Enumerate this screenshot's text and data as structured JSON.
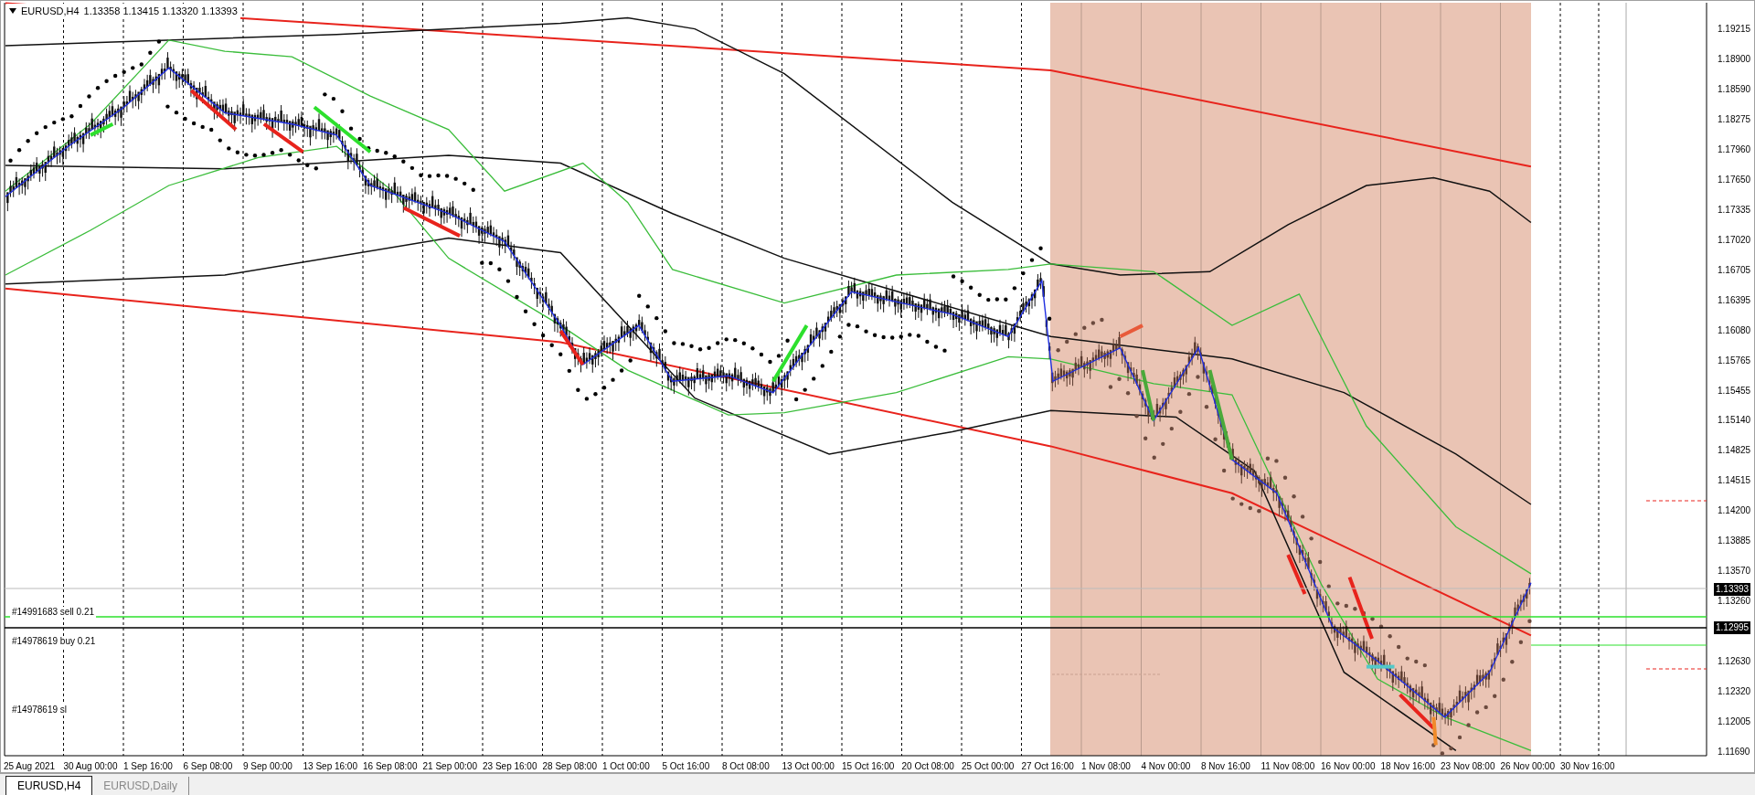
{
  "chart_header": {
    "symbol": "EURUSD,H4",
    "quote": "1.13358 1.13415 1.13320 1.13393"
  },
  "price_axis": {
    "ticks": [
      "1.19215",
      "1.18900",
      "1.18590",
      "1.18275",
      "1.17960",
      "1.17650",
      "1.17335",
      "1.17020",
      "1.16705",
      "1.16395",
      "1.16080",
      "1.15765",
      "1.15455",
      "1.15140",
      "1.14825",
      "1.14515",
      "1.14200",
      "1.13885",
      "1.13570",
      "1.13260",
      "1.12630",
      "1.12320",
      "1.12005",
      "1.11690"
    ],
    "markers": [
      {
        "label": "1.13393",
        "kind": "bid"
      },
      {
        "label": "1.12995",
        "kind": "order"
      }
    ]
  },
  "orders": [
    {
      "label": "#14991683 sell 0.21",
      "kind": "sell"
    },
    {
      "label": "#14978619 buy 0.21",
      "kind": "buy"
    },
    {
      "label": "#14978619 sl",
      "kind": "sl"
    }
  ],
  "time_axis": [
    "25 Aug 2021",
    "30 Aug 00:00",
    "1 Sep 16:00",
    "6 Sep 08:00",
    "9 Sep 00:00",
    "13 Sep 16:00",
    "16 Sep 08:00",
    "21 Sep 00:00",
    "23 Sep 16:00",
    "28 Sep 08:00",
    "1 Oct 00:00",
    "5 Oct 16:00",
    "8 Oct 08:00",
    "13 Oct 00:00",
    "15 Oct 16:00",
    "20 Oct 08:00",
    "25 Oct 00:00",
    "27 Oct 16:00",
    "1 Nov 08:00",
    "4 Nov 00:00",
    "8 Nov 16:00",
    "11 Nov 08:00",
    "16 Nov 00:00",
    "18 Nov 16:00",
    "23 Nov 08:00",
    "26 Nov 00:00",
    "30 Nov 16:00"
  ],
  "tabs": [
    {
      "label": "EURUSD,H4",
      "selected": true
    },
    {
      "label": "EURUSD,Daily",
      "selected": false
    }
  ]
}
